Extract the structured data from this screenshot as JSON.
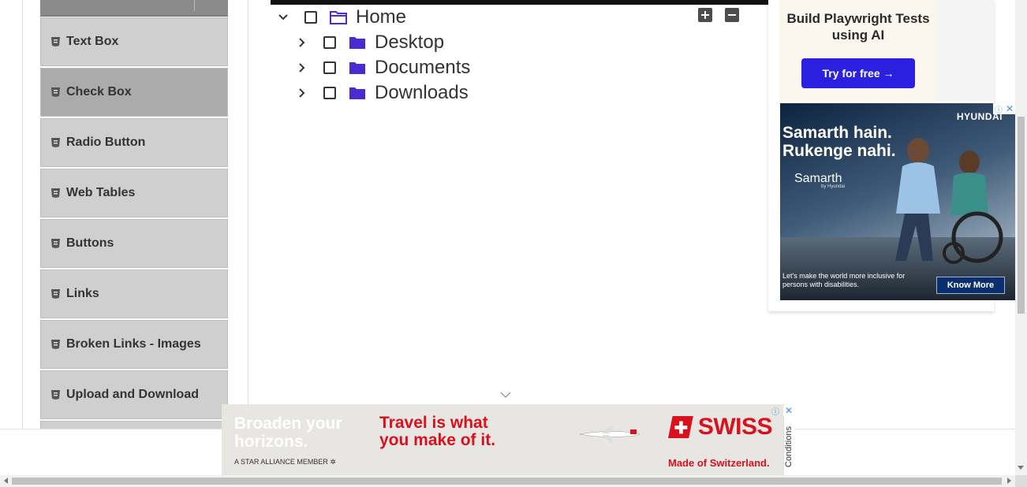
{
  "sidebar": {
    "items": [
      {
        "label": "Text Box",
        "active": false
      },
      {
        "label": "Check Box",
        "active": true
      },
      {
        "label": "Radio Button",
        "active": false
      },
      {
        "label": "Web Tables",
        "active": false
      },
      {
        "label": "Buttons",
        "active": false
      },
      {
        "label": "Links",
        "active": false
      },
      {
        "label": "Broken Links - Images",
        "active": false
      },
      {
        "label": "Upload and Download",
        "active": false
      }
    ]
  },
  "tree": {
    "root": {
      "label": "Home",
      "expanded": true,
      "checked": false
    },
    "children": [
      {
        "label": "Desktop",
        "expanded": false,
        "checked": false
      },
      {
        "label": "Documents",
        "expanded": false,
        "checked": false
      },
      {
        "label": "Downloads",
        "expanded": false,
        "checked": false
      }
    ],
    "expand_all_icon": "plus-square-icon",
    "collapse_all_icon": "minus-square-icon",
    "folder_color": "#4b2bd0"
  },
  "ads": {
    "playwright": {
      "title": "Build Playwright Tests using AI",
      "button": "Try for free →"
    },
    "hyundai": {
      "brand_logo": "HYUNDAI",
      "headline": "Samarth hain. Rukenge nahi.",
      "sub_brand": "Samarth",
      "sub_brand_by": "by Hyundai",
      "tagline": "Let's make the world more inclusive for persons with disabilities.",
      "cta": "Know More"
    },
    "swiss": {
      "headline_left": "Broaden your horizons.",
      "alliance": "A STAR ALLIANCE MEMBER",
      "headline_right": "Travel is what you make of it.",
      "logo": "SWISS",
      "tagline": "Made of Switzerland.",
      "conditions": "Conditions"
    }
  },
  "colors": {
    "active_menu": "#ababab",
    "menu": "#cfcfcf",
    "playwright_button": "#2b1fe0",
    "swiss_red": "#d9101d"
  }
}
